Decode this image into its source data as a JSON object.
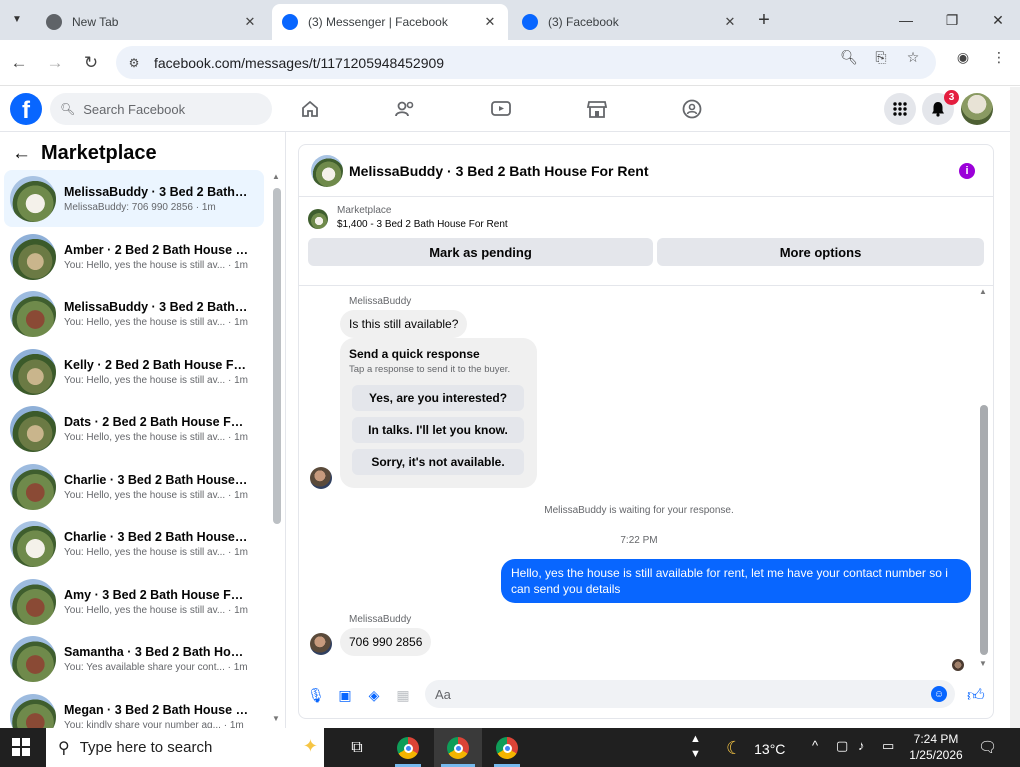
{
  "browser": {
    "tabs": [
      {
        "title": "New Tab",
        "active": false,
        "icon": "chrome-icon"
      },
      {
        "title": "(3) Messenger | Facebook",
        "active": true,
        "icon": "facebook-icon"
      },
      {
        "title": "(3) Facebook",
        "active": false,
        "icon": "facebook-icon"
      }
    ],
    "url": "facebook.com/messages/t/1171205948452909"
  },
  "facebook": {
    "search_placeholder": "Search Facebook",
    "notification_count": "3",
    "brand_color": "#0866ff"
  },
  "sidebar": {
    "title": "Marketplace",
    "conversations": [
      {
        "name": "MelissaBuddy · 3 Bed 2 Bath Ho...",
        "preview": "MelissaBuddy: 706 990 2856 · 1m",
        "selected": true
      },
      {
        "name": "Amber · 2 Bed 2 Bath House Fo...",
        "preview": "You: Hello, yes the house is still av... · 1m"
      },
      {
        "name": "MelissaBuddy · 3 Bed 2 Bath Ho...",
        "preview": "You: Hello, yes the house is still av... · 1m"
      },
      {
        "name": "Kelly · 2 Bed 2 Bath House For R...",
        "preview": "You: Hello, yes the house is still av... · 1m"
      },
      {
        "name": "Dats · 2 Bed 2 Bath House For R...",
        "preview": "You: Hello, yes the house is still av... · 1m"
      },
      {
        "name": "Charlie · 3 Bed 2 Bath House Fo...",
        "preview": "You: Hello, yes the house is still av... · 1m"
      },
      {
        "name": "Charlie · 3 Bed 2 Bath House Fo...",
        "preview": "You: Hello, yes the house is still av... · 1m"
      },
      {
        "name": "Amy · 3 Bed 2 Bath House For R...",
        "preview": "You: Hello, yes the house is still av... · 1m"
      },
      {
        "name": "Samantha · 3 Bed 2 Bath House...",
        "preview": "You: Yes available share your cont... · 1m"
      },
      {
        "name": "Megan · 3 Bed 2 Bath House Fo...",
        "preview": "You: kindly share your number ag... · 1m"
      }
    ]
  },
  "chat": {
    "title": "MelissaBuddy · 3 Bed 2 Bath House For Rent",
    "marketplace_label": "Marketplace",
    "listing": "$1,400 - 3 Bed 2 Bath House For Rent",
    "mark_pending": "Mark as pending",
    "more_options": "More options",
    "sender_name": "MelissaBuddy",
    "msg1": "Is this still available?",
    "quick_title": "Send a quick response",
    "quick_sub": "Tap a response to send it to the buyer.",
    "quick_options": [
      "Yes, are you interested?",
      "In talks. I'll let you know.",
      "Sorry, it's not available."
    ],
    "waiting": "MelissaBuddy is waiting for your response.",
    "time": "7:22 PM",
    "my_msg": "Hello, yes the house is still available for rent, let me have your contact number so i can send you  details",
    "msg2": "706 990 2856",
    "composer_placeholder": "Aa"
  },
  "taskbar": {
    "search_placeholder": "Type here to search",
    "temperature": "13°C",
    "time": "7:24 PM",
    "date": "1/25/2026"
  }
}
